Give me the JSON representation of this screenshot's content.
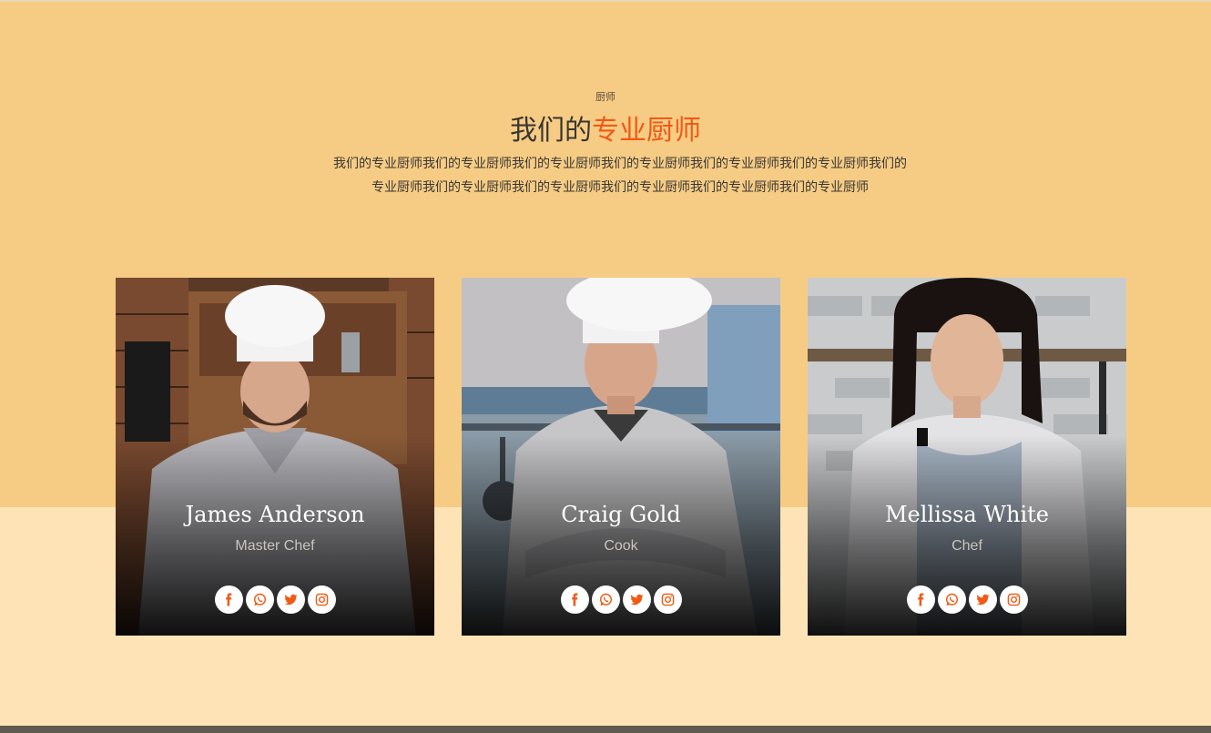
{
  "section": {
    "eyebrow": "厨师",
    "title_part1": "我们的",
    "title_accent": "专业厨师",
    "description": "我们的专业厨师我们的专业厨师我们的专业厨师我们的专业厨师我们的专业厨师我们的专业厨师我们的专业厨师我们的专业厨师我们的专业厨师我们的专业厨师我们的专业厨师我们的专业厨师"
  },
  "colors": {
    "accent": "#f05a14",
    "top_band": "#f6cc85",
    "bottom_band": "#fde3b5"
  },
  "chefs": [
    {
      "name": "James Anderson",
      "role": "Master Chef"
    },
    {
      "name": "Craig Gold",
      "role": "Cook"
    },
    {
      "name": "Mellissa White",
      "role": "Chef"
    }
  ],
  "social_icons": [
    "facebook-icon",
    "whatsapp-icon",
    "twitter-icon",
    "instagram-icon"
  ]
}
